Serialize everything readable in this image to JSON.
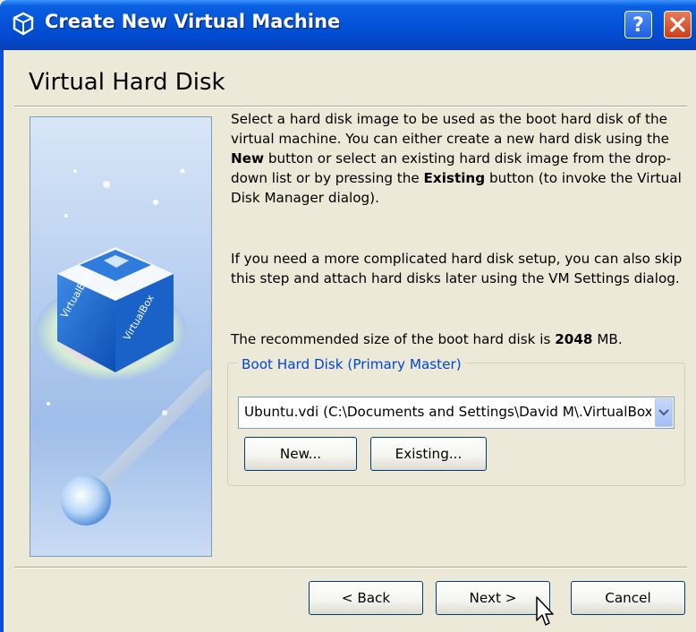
{
  "window": {
    "title": "Create New Virtual Machine",
    "help_label": "?",
    "close_label": "close"
  },
  "page": {
    "heading": "Virtual Hard Disk",
    "image_icon": "virtualbox-cube-and-disc",
    "para1_a": "Select a hard disk image to be used as the boot hard disk of the virtual machine. You can either create a new hard disk using the ",
    "para1_b": "New",
    "para1_c": " button or select an existing hard disk image from the drop-down list or by pressing the ",
    "para1_d": "Existing",
    "para1_e": " button (to invoke the Virtual Disk Manager dialog).",
    "para2": "If you need a more complicated hard disk setup, you can also skip this step and attach hard disks later using the VM Settings dialog.",
    "para3_a": "The recommended size of the boot hard disk is ",
    "para3_b": "2048",
    "para3_c": " MB."
  },
  "boot_disk": {
    "legend": "Boot Hard Disk (Primary Master)",
    "selected": "Ubuntu.vdi (C:\\Documents and Settings\\David M\\.VirtualBox\\VDI\\Ubuntu.vdi)",
    "new_label": "New...",
    "existing_label": "Existing..."
  },
  "footer": {
    "back_label": "< Back",
    "next_label": "Next >",
    "cancel_label": "Cancel"
  },
  "colors": {
    "titlebar": "#0454d8",
    "dialog_bg": "#ece9d8",
    "legend": "#0046d5"
  }
}
